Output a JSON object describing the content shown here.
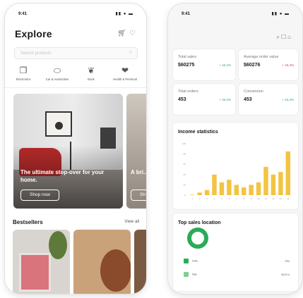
{
  "left_app": {
    "time": "9:41",
    "signal": "▮▮ ● ▬",
    "title": "Explore",
    "search_placeholder": "Search products",
    "categories": [
      {
        "icon": "laptop-icon",
        "glyph": "❐",
        "label": "Electronics"
      },
      {
        "icon": "car-icon",
        "glyph": "⬭",
        "label": "Car & Automotive"
      },
      {
        "icon": "book-icon",
        "glyph": "❦",
        "label": "Book"
      },
      {
        "icon": "health-icon",
        "glyph": "❤",
        "label": "Health & Personal"
      }
    ],
    "banners": [
      {
        "heading": "The ultimate stop-over for your home.",
        "button": "Shop now"
      },
      {
        "heading": "A bri… ward…",
        "button": "Sh"
      }
    ],
    "bestsellers_title": "Bestsellers",
    "view_all": "View all"
  },
  "right_app": {
    "time": "9:41",
    "signal": "▮▮ ● ▬",
    "kpis": [
      {
        "label": "Total sales",
        "value": "$60275",
        "change": "+ 43,4%",
        "color": "#2bab5a"
      },
      {
        "label": "Average order value",
        "value": "$60276",
        "change": "+ 43,4%",
        "color": "#d43c3c"
      },
      {
        "label": "Total orders",
        "value": "453",
        "change": "+ 43,4%",
        "color": "#2bab5a"
      },
      {
        "label": "Conversion",
        "value": "453",
        "change": "+ 43,4%",
        "color": "#2bab5a"
      }
    ],
    "income_title": "Income statistics",
    "top_sales_title": "Top sales location",
    "locations": [
      {
        "name": "India",
        "value": "75%"
      },
      {
        "name": "Italy",
        "value": "$4,51 k"
      }
    ]
  },
  "colors": {
    "accent_green": "#2bab5a",
    "bar_yellow": "#f3c443",
    "sale_red": "#d43c3c"
  },
  "chart_data": {
    "type": "bar",
    "title": "Income statistics",
    "categories": [
      "1",
      "2",
      "3",
      "4",
      "5",
      "6",
      "7",
      "8",
      "9",
      "10",
      "11",
      "12",
      "13",
      "14"
    ],
    "values": [
      1,
      5,
      10,
      40,
      25,
      30,
      20,
      15,
      20,
      25,
      55,
      40,
      45,
      85
    ],
    "ylim": [
      0,
      100
    ],
    "yticks": [
      "100",
      "80",
      "60",
      "40",
      "20",
      "0"
    ],
    "grid": false,
    "color": "#f3c443"
  }
}
